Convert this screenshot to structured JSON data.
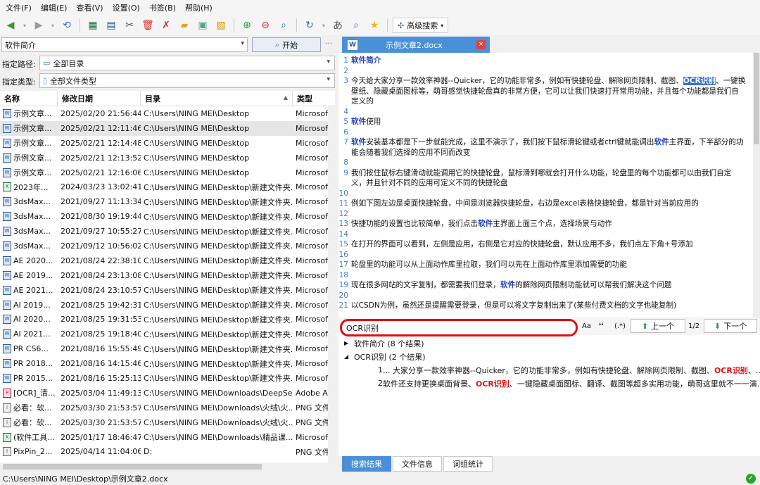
{
  "menu": [
    "文件(F)",
    "编辑(E)",
    "查看(V)",
    "设置(O)",
    "书签(B)",
    "帮助(H)"
  ],
  "toolbar": {
    "advanced_search": "高级搜索"
  },
  "search": {
    "value": "软件简介",
    "start": "开始",
    "more": "···"
  },
  "path": {
    "label": "指定路径:",
    "value": "全部目录"
  },
  "type": {
    "label": "指定类型:",
    "value": "全部文件类型"
  },
  "columns": [
    "名称",
    "修改日期",
    "目录",
    "类型"
  ],
  "files": [
    {
      "name": "示例文章...",
      "date": "2025/02/20 21:56:44",
      "dir": "C:\\Users\\NING MEI\\Desktop",
      "type": "Microsof",
      "icon": "W"
    },
    {
      "name": "示例文章...",
      "date": "2025/02/21 12:11:46",
      "dir": "C:\\Users\\NING MEI\\Desktop",
      "type": "Microsof",
      "icon": "W"
    },
    {
      "name": "示例文章...",
      "date": "2025/02/21 12:14:48",
      "dir": "C:\\Users\\NING MEI\\Desktop",
      "type": "Microsof",
      "icon": "W"
    },
    {
      "name": "示例文章...",
      "date": "2025/02/21 12:13:52",
      "dir": "C:\\Users\\NING MEI\\Desktop",
      "type": "Microsof",
      "icon": "W"
    },
    {
      "name": "示例文章...",
      "date": "2025/02/21 12:16:06",
      "dir": "C:\\Users\\NING MEI\\Desktop",
      "type": "Microsof",
      "icon": "W"
    },
    {
      "name": "2023年...",
      "date": "2024/03/23 13:02:41",
      "dir": "C:\\Users\\NING MEI\\Desktop\\新建文件夹...",
      "type": "Microsof",
      "icon": "X"
    },
    {
      "name": "3dsMax...",
      "date": "2021/09/27 11:13:34",
      "dir": "C:\\Users\\NING MEI\\Desktop\\新建文件夹...",
      "type": "Microsof",
      "icon": "W"
    },
    {
      "name": "3dsMax...",
      "date": "2021/08/30 19:19:44",
      "dir": "C:\\Users\\NING MEI\\Desktop\\新建文件夹...",
      "type": "Microsof",
      "icon": "W"
    },
    {
      "name": "3dsMax...",
      "date": "2021/09/27 10:55:27",
      "dir": "C:\\Users\\NING MEI\\Desktop\\新建文件夹...",
      "type": "Microsof",
      "icon": "W"
    },
    {
      "name": "3dsMax...",
      "date": "2021/09/12 10:56:02",
      "dir": "C:\\Users\\NING MEI\\Desktop\\新建文件夹...",
      "type": "Microsof",
      "icon": "W"
    },
    {
      "name": "AE 2020...",
      "date": "2021/08/24 22:38:10",
      "dir": "C:\\Users\\NING MEI\\Desktop\\新建文件夹...",
      "type": "Microsof",
      "icon": "W"
    },
    {
      "name": "AE 2019...",
      "date": "2021/08/24 23:13:08",
      "dir": "C:\\Users\\NING MEI\\Desktop\\新建文件夹...",
      "type": "Microsof",
      "icon": "W"
    },
    {
      "name": "AE 2021...",
      "date": "2021/08/24 23:10:57",
      "dir": "C:\\Users\\NING MEI\\Desktop\\新建文件夹...",
      "type": "Microsof",
      "icon": "W"
    },
    {
      "name": "AI 2019...",
      "date": "2021/08/25 19:42:31",
      "dir": "C:\\Users\\NING MEI\\Desktop\\新建文件夹...",
      "type": "Microsof",
      "icon": "W"
    },
    {
      "name": "AI 2020...",
      "date": "2021/08/25 19:31:53",
      "dir": "C:\\Users\\NING MEI\\Desktop\\新建文件夹...",
      "type": "Microsof",
      "icon": "W"
    },
    {
      "name": "AI 2021...",
      "date": "2021/08/25 19:18:40",
      "dir": "C:\\Users\\NING MEI\\Desktop\\新建文件夹...",
      "type": "Microsof",
      "icon": "W"
    },
    {
      "name": "PR CS6...",
      "date": "2021/08/16 15:55:49",
      "dir": "C:\\Users\\NING MEI\\Desktop\\新建文件夹...",
      "type": "Microsof",
      "icon": "W"
    },
    {
      "name": "PR 2018...",
      "date": "2021/08/16 14:15:46",
      "dir": "C:\\Users\\NING MEI\\Desktop\\新建文件夹...",
      "type": "Microsof",
      "icon": "W"
    },
    {
      "name": "PR 2015...",
      "date": "2021/08/16 15:25:13",
      "dir": "C:\\Users\\NING MEI\\Desktop\\新建文件夹...",
      "type": "Microsof",
      "icon": "W"
    },
    {
      "name": "[OCR]_清...",
      "date": "2025/03/04 11:49:13",
      "dir": "C:\\Users\\NING MEI\\Downloads\\DeepSe...",
      "type": "Adobe A",
      "icon": "P"
    },
    {
      "name": "必看：软...",
      "date": "2025/03/30 21:53:57",
      "dir": "C:\\Users\\NING MEI\\Downloads\\火绒\\火...",
      "type": "PNG 文件",
      "icon": "I"
    },
    {
      "name": "必看：软...",
      "date": "2025/03/30 21:53:57",
      "dir": "C:\\Users\\NING MEI\\Downloads\\火绒\\火...",
      "type": "PNG 文件",
      "icon": "I"
    },
    {
      "name": "(软件工具...",
      "date": "2025/01/17 18:46:47",
      "dir": "C:\\Users\\NING MEI\\Downloads\\精品课...",
      "type": "Microsof",
      "icon": "X"
    },
    {
      "name": "PixPin_2...",
      "date": "2025/04/14 11:04:06",
      "dir": "D:",
      "type": "PNG 文件",
      "icon": "I"
    }
  ],
  "doc_tab": {
    "title": "示例文章2.docx",
    "close": "×",
    "icon": "W"
  },
  "editor_lines": [
    {
      "n": "1",
      "html": "<span class='kw'>软件简介</span>"
    },
    {
      "n": "2",
      "html": ""
    },
    {
      "n": "3",
      "html": "今天给大家分享一款效率神器--Quicker，它的功能非常多，例如有快捷轮盘、解除网页限制、截图、<span class='hl'>OCR识别</span>、一键换壁纸、隐藏桌面图标等，萌哥感觉快捷轮盘真的非常方便，它可以让我们快速打开常用功能，并且每个功能都是我们自定义的"
    },
    {
      "n": "4",
      "html": ""
    },
    {
      "n": "5",
      "html": "<span class='kw'>软件</span>使用"
    },
    {
      "n": "6",
      "html": ""
    },
    {
      "n": "7",
      "html": "<span class='kw'>软件</span>安装基本都是下一步就能完成，这里不演示了，我们按下鼠标滑轮键或者ctrl键就能调出<span class='kw'>软件</span>主界面，下半部分的功能会随着我们选择的应用不同而改变"
    },
    {
      "n": "8",
      "html": ""
    },
    {
      "n": "9",
      "html": "我们按住鼠标右键滑动就能调用它的快捷轮盘，鼠标滑到哪就会打开什么功能，轮盘里的每个功能都可以由我们自定义，并且针对不同的应用可定义不同的快捷轮盘"
    },
    {
      "n": "10",
      "html": ""
    },
    {
      "n": "11",
      "html": "例如下图左边是桌面快捷轮盘，中间是浏览器快捷轮盘，右边是excel表格快捷轮盘，都是针对当前应用的"
    },
    {
      "n": "12",
      "html": ""
    },
    {
      "n": "13",
      "html": "快捷功能的设置也比较简单，我们点击<span class='kw'>软件</span>主界面上面三个点，选择场景与动作"
    },
    {
      "n": "14",
      "html": ""
    },
    {
      "n": "15",
      "html": "在打开的界面可以看到，左侧是应用，右侧是它对应的快捷轮盘，默认应用不多，我们点左下角+号添加"
    },
    {
      "n": "16",
      "html": ""
    },
    {
      "n": "17",
      "html": "轮盘里的功能可以从上面动作库里拉取，我们可以先在上面动作库里添加需要的功能"
    },
    {
      "n": "18",
      "html": ""
    },
    {
      "n": "19",
      "html": "现在很多网站的文字复制，都需要我们登录，<span class='kw'>软件</span>的解除网页限制功能就可以帮我们解决这个问题"
    },
    {
      "n": "20",
      "html": ""
    },
    {
      "n": "21",
      "html": "以CSDN为例，虽然还是提醒需要登录，但是可以将文字复制出来了(某些付费文档的文字也能复制)"
    }
  ],
  "find": {
    "value": "OCR识别",
    "opt_case": "Aa",
    "opt_word": "❛❛",
    "opt_regex": "(.*)",
    "prev": "上一个",
    "count": "1/2",
    "next": "下一个"
  },
  "results": {
    "group1": "软件简介 (8 个结果)",
    "group2": "OCR识别 (2 个结果)",
    "r1_num": "1",
    "r1_pre": "... 大家分享一款效率神器--Quicker，它的功能非常多，例如有快捷轮盘、解除网页限制、截图、",
    "r1_hit": "OCR识别",
    "r1_post": "、...",
    "r2_num": "2",
    "r2_pre": "软件还支持更换桌面背景、",
    "r2_hit": "OCR识别",
    "r2_post": "、一键隐藏桌面图标、翻译、截图等超多实用功能，萌哥这里就不一一演..."
  },
  "bottom_tabs": [
    "搜索结果",
    "文件信息",
    "词组统计"
  ],
  "status": {
    "path": "C:\\Users\\NING MEI\\Desktop\\示例文章2.docx",
    "ok": "✓"
  },
  "colors": {
    "accent": "#4a90d9",
    "highlight": "#3b6fd6",
    "find_border": "#e01010"
  }
}
